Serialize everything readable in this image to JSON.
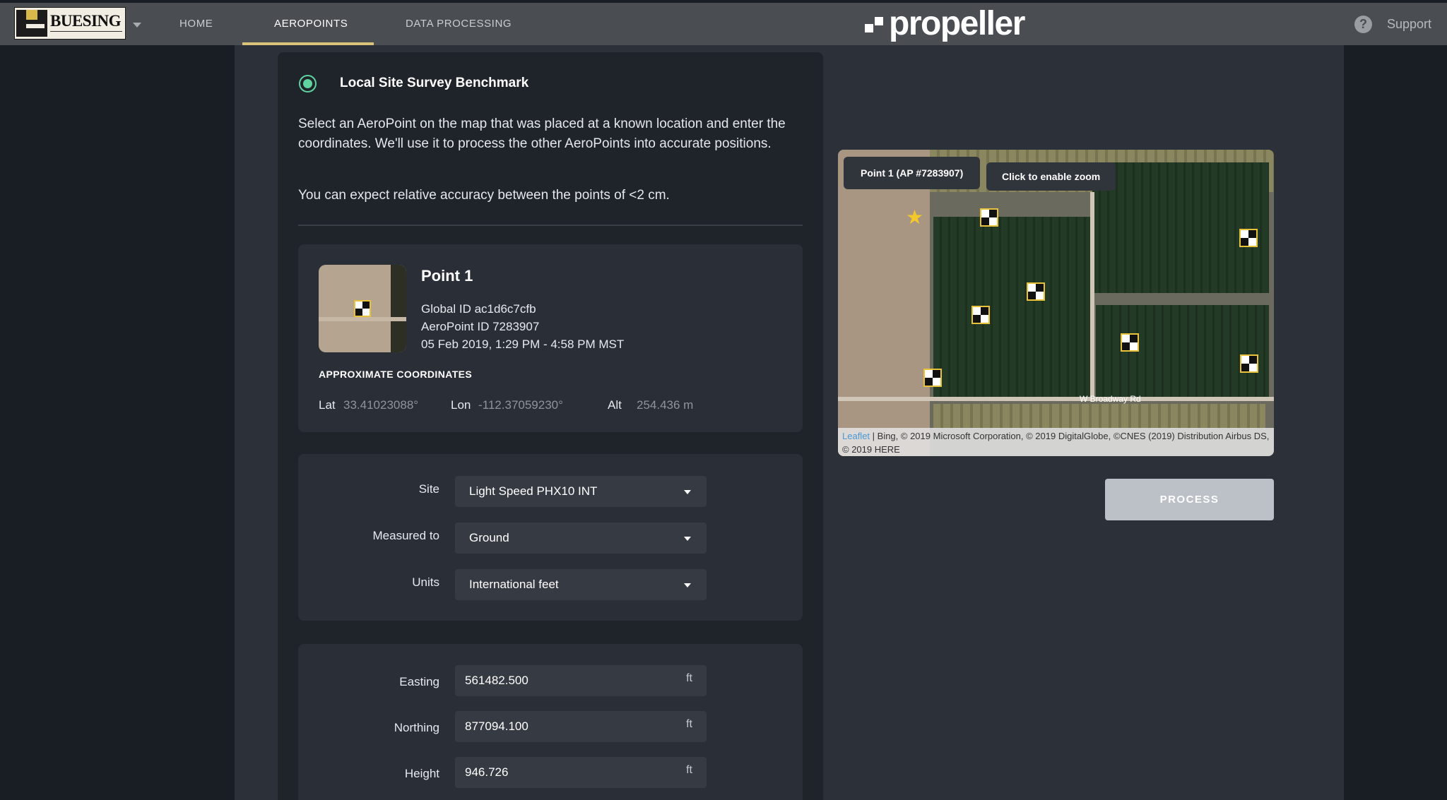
{
  "header": {
    "logo_text": "BUESING",
    "nav": [
      "HOME",
      "AEROPOINTS",
      "DATA PROCESSING"
    ],
    "active_tab": "AEROPOINTS",
    "brand": "propeller",
    "support": "Support",
    "help_glyph": "?"
  },
  "panel": {
    "title": "Local Site Survey Benchmark",
    "description": "Select an AeroPoint on the map that was placed at a known location and enter the coordinates. We'll use it to process the other AeroPoints into accurate positions.",
    "accuracy": "You can expect relative accuracy between the points of <2 cm."
  },
  "point": {
    "name": "Point 1",
    "global_id": "Global ID ac1d6c7cfb",
    "aeropoint_id": "AeroPoint ID 7283907",
    "time": "05 Feb 2019, 1:29 PM - 4:58 PM MST",
    "coords_header": "APPROXIMATE COORDINATES",
    "lat_label": "Lat",
    "lat": "33.41023088°",
    "lon_label": "Lon",
    "lon": "-112.37059230°",
    "alt_label": "Alt",
    "alt": "254.436 m"
  },
  "settings": {
    "site_label": "Site",
    "site_value": "Light Speed PHX10 INT",
    "measured_label": "Measured to",
    "measured_value": "Ground",
    "units_label": "Units",
    "units_value": "International feet"
  },
  "coordinates": {
    "easting_label": "Easting",
    "easting": "561482.500",
    "northing_label": "Northing",
    "northing": "877094.100",
    "height_label": "Height",
    "height": "946.726",
    "unit": "ft"
  },
  "map": {
    "tooltip": "Point 1 (AP #7283907)",
    "zoom_button": "Click to enable zoom",
    "road_label": "W Broadway Rd",
    "attribution_link": "Leaflet",
    "attribution": " | Bing, © 2019 Microsoft Corporation, © 2019 DigitalGlobe, ©CNES (2019) Distribution Airbus DS, © 2019 HERE",
    "star_glyph": "★"
  },
  "actions": {
    "process": "PROCESS"
  },
  "colors": {
    "accent_green": "#5fd3a0",
    "nav_underline": "#d9c27a",
    "panel_bg": "#1f232a",
    "card_bg": "#2a2e36",
    "process_disabled": "#bcc1c8"
  }
}
